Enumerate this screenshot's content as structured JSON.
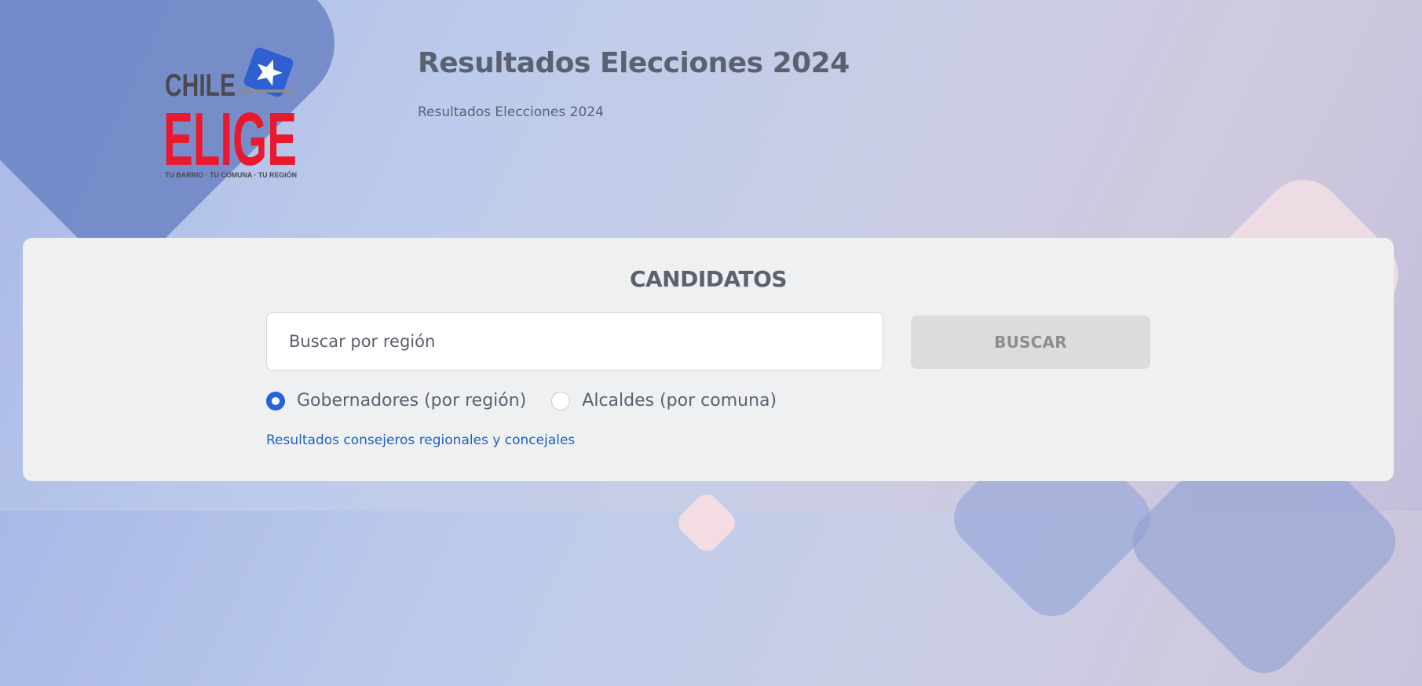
{
  "header": {
    "title": "Resultados Elecciones 2024",
    "subtitle": "Resultados Elecciones 2024"
  },
  "logo": {
    "line1": "CHILE",
    "line2": "ELIGE",
    "tagline": "TU BARRIO · TU COMUNA · TU REGIÓN",
    "icon": "star-ballot-icon",
    "colors": {
      "dark": "#4a4a4f",
      "red": "#e8192c",
      "blue": "#2f5fd0"
    }
  },
  "search": {
    "title": "CANDIDATOS",
    "placeholder": "Buscar por región",
    "button_label": "BUSCAR",
    "options": [
      {
        "label": "Gobernadores (por región)",
        "selected": true
      },
      {
        "label": "Alcaldes (por comuna)",
        "selected": false
      }
    ],
    "link_text": "Resultados consejeros regionales y concejales"
  },
  "colors": {
    "accent": "#2565d8",
    "link": "#1f5fc4",
    "text": "#5a6170",
    "card_background": "#eff0f2",
    "button_disabled": "#dcdcdc"
  }
}
